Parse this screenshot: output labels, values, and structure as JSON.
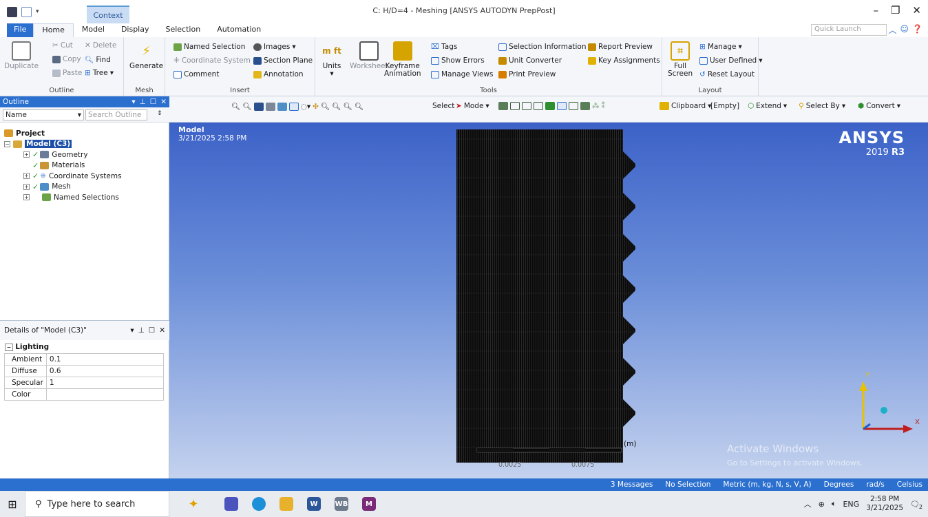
{
  "titlebar": {
    "context_tab": "Context",
    "title": "C: H/D=4 - Meshing [ANSYS AUTODYN PrepPost]"
  },
  "tabs": [
    "File",
    "Home",
    "Model",
    "Display",
    "Selection",
    "Automation"
  ],
  "quick_launch_placeholder": "Quick Launch",
  "ribbon": {
    "outline": {
      "label": "Outline",
      "duplicate": "Duplicate",
      "cut": "Cut",
      "copy": "Copy",
      "paste": "Paste",
      "delete": "Delete",
      "find": "Find",
      "tree": "Tree"
    },
    "mesh": {
      "label": "Mesh",
      "generate": "Generate"
    },
    "insert": {
      "label": "Insert",
      "named_selection": "Named Selection",
      "coordinate_system": "Coordinate System",
      "comment": "Comment",
      "images": "Images",
      "section_plane": "Section Plane",
      "annotation": "Annotation"
    },
    "tools": {
      "label": "Tools",
      "units": "Units",
      "worksheet": "Worksheet",
      "keyframe_animation_1": "Keyframe",
      "keyframe_animation_2": "Animation",
      "tags": "Tags",
      "show_errors": "Show Errors",
      "manage_views": "Manage Views",
      "selection_information": "Selection Information",
      "unit_converter": "Unit Converter",
      "print_preview": "Print Preview",
      "report_preview": "Report Preview",
      "key_assignments": "Key Assignments"
    },
    "layout": {
      "label": "Layout",
      "full_screen_1": "Full",
      "full_screen_2": "Screen",
      "manage": "Manage",
      "user_defined": "User Defined",
      "reset_layout": "Reset Layout"
    }
  },
  "outline": {
    "header": "Outline",
    "name_dropdown": "Name",
    "search_placeholder": "Search Outline",
    "tree": [
      "Project",
      "Model (C3)",
      "Geometry",
      "Materials",
      "Coordinate Systems",
      "Mesh",
      "Named Selections"
    ]
  },
  "details": {
    "header": "Details of \"Model (C3)\"",
    "category": "Lighting",
    "rows": [
      {
        "name": "Ambient",
        "value": "0.1"
      },
      {
        "name": "Diffuse",
        "value": "0.6"
      },
      {
        "name": "Specular",
        "value": "1"
      },
      {
        "name": "Color",
        "value": ""
      }
    ]
  },
  "viewport_toolbar": {
    "select": "Select",
    "mode": "Mode",
    "clipboard": "Clipboard",
    "empty": "[Empty]",
    "extend": "Extend",
    "select_by": "Select By",
    "convert": "Convert"
  },
  "viewport": {
    "model_label": "Model",
    "date": "3/21/2025 2:58 PM",
    "logo": "ANSYS",
    "version": "2019",
    "version_bold": "R3",
    "scale_unit": "(m)",
    "scale_label_1": "0.0025",
    "scale_label_2": "0.0075",
    "triad_y": "Y",
    "triad_x": "X",
    "watermark_title": "Activate Windows",
    "watermark_sub": "Go to Settings to activate Windows."
  },
  "statusbar": {
    "messages": "3 Messages",
    "selection": "No Selection",
    "units": "Metric (m, kg, N, s, V, A)",
    "angle": "Degrees",
    "rate": "rad/s",
    "temp": "Celsius"
  },
  "taskbar": {
    "search_placeholder": "Type here to search",
    "lang": "ENG",
    "time": "2:58 PM",
    "date": "3/21/2025",
    "notif_count": "2"
  },
  "colors": {
    "accent": "#2b6fcf",
    "viewport_top": "#3c62c8",
    "viewport_bottom": "#c4d2ee",
    "tree_selected": "#1c4fa8"
  }
}
